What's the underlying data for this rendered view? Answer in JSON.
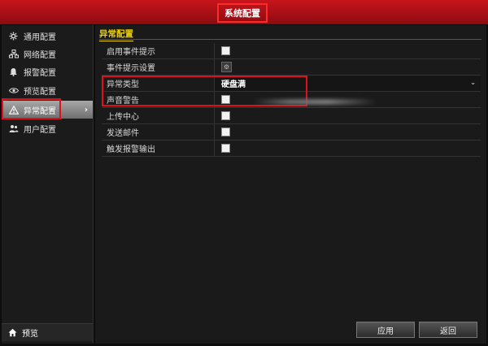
{
  "window": {
    "title": "系统配置"
  },
  "sidebar": {
    "items": [
      {
        "label": "通用配置",
        "icon": "gear-icon"
      },
      {
        "label": "网络配置",
        "icon": "network-icon"
      },
      {
        "label": "报警配置",
        "icon": "alarm-icon"
      },
      {
        "label": "预览配置",
        "icon": "eye-icon"
      },
      {
        "label": "异常配置",
        "icon": "warning-icon",
        "active": true,
        "arrow": "›"
      },
      {
        "label": "用户配置",
        "icon": "user-icon"
      }
    ],
    "bottom": {
      "label": "预览",
      "icon": "home-icon"
    }
  },
  "main": {
    "section_title": "异常配置",
    "rows": [
      {
        "label": "启用事件提示",
        "control": "checkbox",
        "checked": false
      },
      {
        "label": "事件提示设置",
        "control": "settings"
      },
      {
        "label": "异常类型",
        "control": "select",
        "value": "硬盘满"
      },
      {
        "label": "声音警告",
        "control": "checkbox",
        "checked": false
      },
      {
        "label": "上传中心",
        "control": "checkbox",
        "checked": false
      },
      {
        "label": "发送邮件",
        "control": "checkbox",
        "checked": false
      },
      {
        "label": "触发报警输出",
        "control": "checkbox",
        "checked": false
      }
    ],
    "settings_glyph": "⚙",
    "chevron_glyph": "⌄"
  },
  "buttons": {
    "apply": "应用",
    "back": "返回"
  },
  "colors": {
    "title_bar": "#b8121a",
    "highlight": "#e0101a",
    "section_title": "#f0d000"
  }
}
